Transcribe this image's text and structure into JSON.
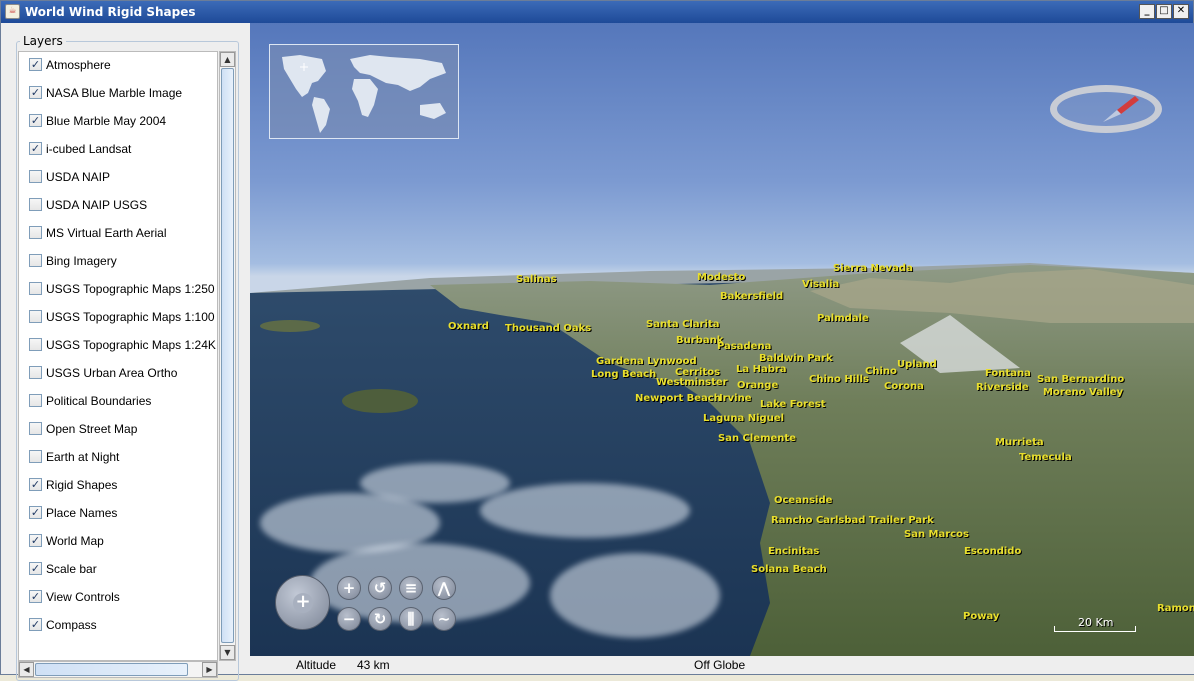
{
  "window": {
    "title": "World Wind Rigid Shapes",
    "minimize": "_",
    "maximize": "□",
    "close": "✕"
  },
  "layers_panel": {
    "title": "Layers",
    "items": [
      {
        "label": "Atmosphere",
        "checked": true
      },
      {
        "label": "NASA Blue Marble Image",
        "checked": true
      },
      {
        "label": "Blue Marble May 2004",
        "checked": true
      },
      {
        "label": "i-cubed Landsat",
        "checked": true
      },
      {
        "label": "USDA NAIP",
        "checked": false
      },
      {
        "label": "USDA NAIP USGS",
        "checked": false
      },
      {
        "label": "MS Virtual Earth Aerial",
        "checked": false
      },
      {
        "label": "Bing Imagery",
        "checked": false
      },
      {
        "label": "USGS Topographic Maps 1:250",
        "checked": false
      },
      {
        "label": "USGS Topographic Maps 1:100",
        "checked": false
      },
      {
        "label": "USGS Topographic Maps 1:24K",
        "checked": false
      },
      {
        "label": "USGS Urban Area Ortho",
        "checked": false
      },
      {
        "label": "Political Boundaries",
        "checked": false
      },
      {
        "label": "Open Street Map",
        "checked": false
      },
      {
        "label": "Earth at Night",
        "checked": false
      },
      {
        "label": "Rigid Shapes",
        "checked": true
      },
      {
        "label": "Place Names",
        "checked": true
      },
      {
        "label": "World Map",
        "checked": true
      },
      {
        "label": "Scale bar",
        "checked": true
      },
      {
        "label": "View Controls",
        "checked": true
      },
      {
        "label": "Compass",
        "checked": true
      }
    ]
  },
  "place_names": [
    "Salinas",
    "Modesto",
    "Sierra Nevada",
    "Bakersfield",
    "Visalia",
    "Oxnard",
    "Thousand Oaks",
    "Santa Clarita",
    "Palmdale",
    "Burbank",
    "Pasadena",
    "Baldwin Park",
    "Gardena Lynwood",
    "La Habra",
    "Long Beach",
    "Cerritos",
    "Westminster",
    "Chino Hills",
    "Chino",
    "Upland",
    "Fontana",
    "San Bernardino",
    "Orange",
    "Corona",
    "Riverside",
    "Moreno Valley",
    "Newport Beach",
    "Irvine",
    "Lake Forest",
    "Laguna Niguel",
    "San Clemente",
    "Murrieta",
    "Temecula",
    "Oceanside",
    "Rancho Carlsbad Trailer Park",
    "San Marcos",
    "Encinitas",
    "Escondido",
    "Solana Beach",
    "Poway",
    "Ramon"
  ],
  "scale_bar": {
    "label": "20 Km"
  },
  "status": {
    "altitude_label": "Altitude",
    "altitude_value": "43 km",
    "position": "Off Globe"
  },
  "icons": {
    "zoom_in": "+",
    "zoom_out": "−"
  }
}
